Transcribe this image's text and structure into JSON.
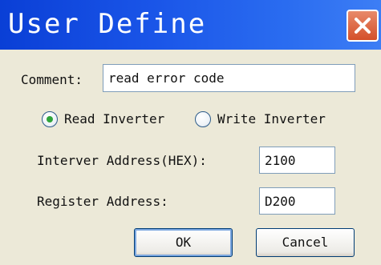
{
  "window": {
    "title": "User Define"
  },
  "comment": {
    "label": "Comment:",
    "value": "read error code"
  },
  "mode": {
    "read_label": "Read Inverter",
    "write_label": "Write Inverter",
    "selected": "read"
  },
  "inverter_address": {
    "label": "Interver Address(HEX):",
    "value": "2100"
  },
  "register_address": {
    "label": "Register Address:",
    "value": "D200"
  },
  "buttons": {
    "ok_label": "OK",
    "cancel_label": "Cancel"
  },
  "icons": {
    "close": "close-icon",
    "radio_checked": "radio-checked-icon",
    "radio_unchecked": "radio-unchecked-icon"
  },
  "colors": {
    "titlebar": "#1a55e8",
    "close_button": "#d4502a",
    "radio_selected_dot": "#2ea43a",
    "dialog_background": "#ece9d8"
  }
}
